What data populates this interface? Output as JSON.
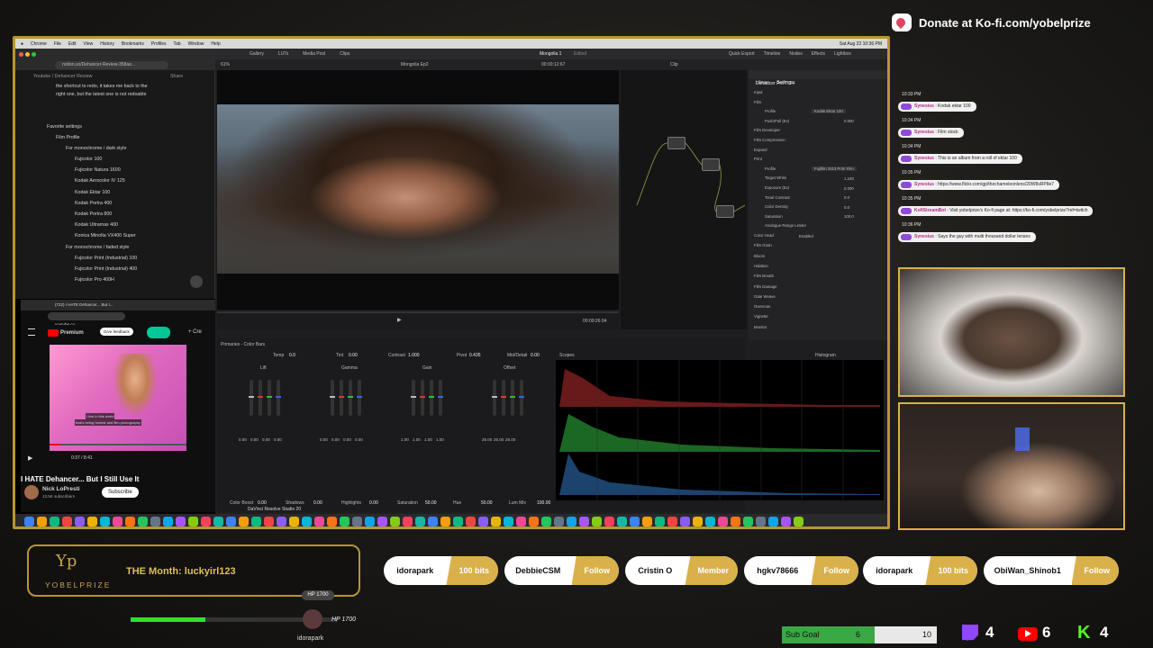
{
  "donate": {
    "text": "Donate at Ko-fi.com/yobelprize"
  },
  "mac_menu": {
    "items": [
      "Chrome",
      "File",
      "Edit",
      "View",
      "History",
      "Bookmarks",
      "Profiles",
      "Tab",
      "Window",
      "Help"
    ],
    "clock": "Sat Aug 23  10:36 PM"
  },
  "notion": {
    "url": "notion.so/Dehancer-Review-358ae...",
    "breadcrumb": [
      "Youtube",
      "Dehancer Review"
    ],
    "share": "Share",
    "para1": "the shortcut to redo, it takes me back to the",
    "para2": "right one, but the latest one is not redoable",
    "fav": "Favorite settings",
    "film_profile": "Film Profile",
    "group1": "For monochrome / dark style",
    "films1": [
      "Fujicolor 100",
      "Fujicolor Natura 1600",
      "Kodak Aerocolor IV 125",
      "Kodak Ektar 100",
      "Kodak Portra 400",
      "Kodak Portra 800",
      "Kodak Ultramax 400",
      "Konica Minolta VX400 Super"
    ],
    "group2": "For monochrome / faded style",
    "films2": [
      "Fujicolor Print (Industrial) 100",
      "Fujicolor Print (Industrial) 400",
      "Fujicolor Pro 400H"
    ]
  },
  "youtube": {
    "tab": "(722) I HATE Dehancer... But I...",
    "url": "youtube.co...",
    "premium": "Premium",
    "feedback": "Give feedback",
    "create": "Cre",
    "caption1": "I live in this world",
    "caption2": "that's being honest and film photography",
    "time": "0:37 / 8:41",
    "title": "I HATE Dehancer... But I Still Use It",
    "channel": "Nick LoPresti",
    "subs": "13.5K subscribers",
    "subscribe": "Subscribe"
  },
  "resolve": {
    "top": [
      "Gallery",
      "LUTs",
      "Media Pool",
      "Clips"
    ],
    "project": "Mongolia 1",
    "edited": "Edited",
    "right_top": [
      "Quick Export",
      "Timeline",
      "Nodes",
      "Effects",
      "Lightbox"
    ],
    "zoom": "61%",
    "clip_name": "Mongolia Ep2",
    "tc1": "00:00:12:67",
    "clip": "Clip",
    "timecode": "00:00:26:04",
    "insp_tabs": [
      "Library",
      "Settings"
    ],
    "plugin": "Dehancer Pro 7.3.4",
    "insp_items": [
      "Input",
      "Film",
      "Profile",
      "Push/Pull (Ev)",
      "Film Developer",
      "Film Compression",
      "Expand",
      "Print",
      "Profile",
      "Target White",
      "Exposure (Ev)",
      "Tonal Contrast",
      "Color Density",
      "Saturation",
      "Analogue Range Limiter",
      "Color Head",
      "Film Grain",
      "Bloom",
      "Halation",
      "Film Breath",
      "Film Damage",
      "Gate Weave",
      "Overscan",
      "Vignette",
      "Monitor"
    ],
    "profile_val": "Kodak Ektar 100",
    "print_val": "Fujifilm 3513 Print Film",
    "enabled": "Enabled",
    "pushval": "0.000",
    "vals": [
      "1.248",
      "0.000",
      "0.0",
      "0.0",
      "100.0"
    ],
    "primaries": "Primaries - Color Bars",
    "temp": "Temp",
    "tint": "Tint",
    "contrast": "Contrast",
    "pivot": "Pivot",
    "middetail": "Mid/Detail",
    "tempv": "0.0",
    "tintv": "0.00",
    "contrastv": "1.000",
    "pivotv": "0.435",
    "mdv": "0.00",
    "wheels": [
      "Lift",
      "Gamma",
      "Gain",
      "Offset"
    ],
    "wheelvals": [
      [
        "0.00",
        "0.00",
        "0.00",
        "0.00"
      ],
      [
        "0.00",
        "0.00",
        "0.00",
        "0.00"
      ],
      [
        "1.00",
        "1.00",
        "1.00",
        "1.00"
      ],
      [
        "25.00",
        "25.00",
        "25.00"
      ]
    ],
    "bottom": [
      "Color Boost",
      "0.00",
      "Shadows",
      "0.00",
      "Highlights",
      "0.00",
      "Saturation",
      "50.00",
      "Hue",
      "50.00",
      "Lum Mix",
      "100.00"
    ],
    "scopes": "Scopes",
    "histogram": "Histogram",
    "app": "DaVinci Resolve Studio 20",
    "scale": [
      "0",
      "128",
      "256",
      "384",
      "512",
      "640",
      "768",
      "896",
      "1023"
    ]
  },
  "chat": [
    {
      "time": "10:33 PM",
      "user": "Synesius",
      "text": "Kodak ektar 100"
    },
    {
      "time": "10:34 PM",
      "user": "Synesius",
      "text": "Film stock"
    },
    {
      "time": "10:34 PM",
      "user": "Synesius",
      "text": "This is an album from a roll of ektar 100"
    },
    {
      "time": "10:35 PM",
      "user": "Synesius",
      "text": "https://www.flickr.com/gp/thechameleonlens/20W8sRP8e7"
    },
    {
      "time": "10:35 PM",
      "user": "KofiStreamBot",
      "text": "Visit yobelprize's Ko-fi page at: https://ko-fi.com/yobelprize?ref=twitch"
    },
    {
      "time": "10:36 PM",
      "user": "Synesius",
      "text": "Says the guy with multi thousand dollar lenses"
    }
  ],
  "brand": "YOBELPRIZE",
  "month": "THE Month: luckyirl123",
  "events": [
    {
      "name": "idorapark",
      "type": "100 bits"
    },
    {
      "name": "DebbieCSM",
      "type": "Follow"
    },
    {
      "name": "Cristin O",
      "type": "Member"
    },
    {
      "name": "hgkv78666",
      "type": "Follow"
    },
    {
      "name": "idorapark",
      "type": "100 bits"
    },
    {
      "name": "ObiWan_Shinob1",
      "type": "Follow"
    }
  ],
  "game": {
    "hp": "HP 1700",
    "hp2": "HP 1700",
    "player": "idorapark",
    "hp_level": 0.36
  },
  "subgoal": {
    "label": "Sub Goal",
    "current": "6",
    "target": "10",
    "progress": 0.6
  },
  "counts": {
    "twitch": "4",
    "youtube": "6",
    "kick": "4"
  }
}
